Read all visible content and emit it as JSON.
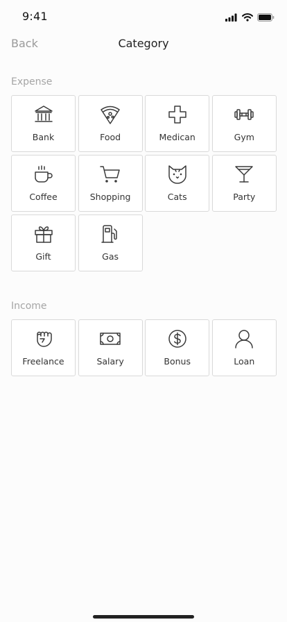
{
  "status_bar": {
    "time": "9:41"
  },
  "nav": {
    "back_label": "Back",
    "title": "Category"
  },
  "expense": {
    "label": "Expense",
    "items": [
      {
        "label": "Bank",
        "icon": "bank-icon"
      },
      {
        "label": "Food",
        "icon": "pizza-icon"
      },
      {
        "label": "Medican",
        "icon": "medical-cross-icon"
      },
      {
        "label": "Gym",
        "icon": "dumbbell-icon"
      },
      {
        "label": "Coffee",
        "icon": "coffee-cup-icon"
      },
      {
        "label": "Shopping",
        "icon": "shopping-cart-icon"
      },
      {
        "label": "Cats",
        "icon": "cat-icon"
      },
      {
        "label": "Party",
        "icon": "cocktail-icon"
      },
      {
        "label": "Gift",
        "icon": "gift-icon"
      },
      {
        "label": "Gas",
        "icon": "gas-pump-icon"
      }
    ]
  },
  "income": {
    "label": "Income",
    "items": [
      {
        "label": "Freelance",
        "icon": "fist-icon"
      },
      {
        "label": "Salary",
        "icon": "banknote-icon"
      },
      {
        "label": "Bonus",
        "icon": "dollar-coin-icon"
      },
      {
        "label": "Loan",
        "icon": "user-icon"
      }
    ]
  }
}
